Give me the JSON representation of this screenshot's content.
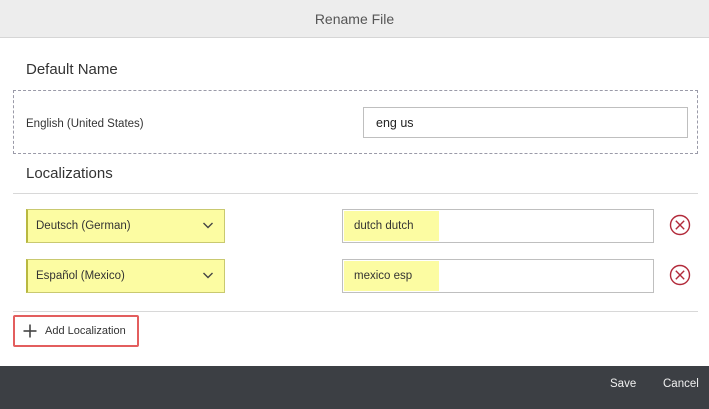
{
  "dialog": {
    "title": "Rename File"
  },
  "default_name": {
    "section_title": "Default Name",
    "language_label": "English (United States)",
    "value": "eng us"
  },
  "localizations": {
    "section_title": "Localizations",
    "rows": [
      {
        "language": "Deutsch (German)",
        "value": "dutch dutch"
      },
      {
        "language": "Español (Mexico)",
        "value": "mexico esp"
      }
    ],
    "add_label": "Add Localization"
  },
  "footer": {
    "save_label": "Save",
    "cancel_label": "Cancel"
  },
  "colors": {
    "highlight": "#fcfca2",
    "remove_icon": "#b22a3a",
    "footer_bg": "#3c3f44",
    "add_button_outline": "#e35e5e"
  },
  "icons": {
    "dropdown": "chevron-down-icon",
    "remove": "remove-circle-icon",
    "add": "plus-icon"
  }
}
